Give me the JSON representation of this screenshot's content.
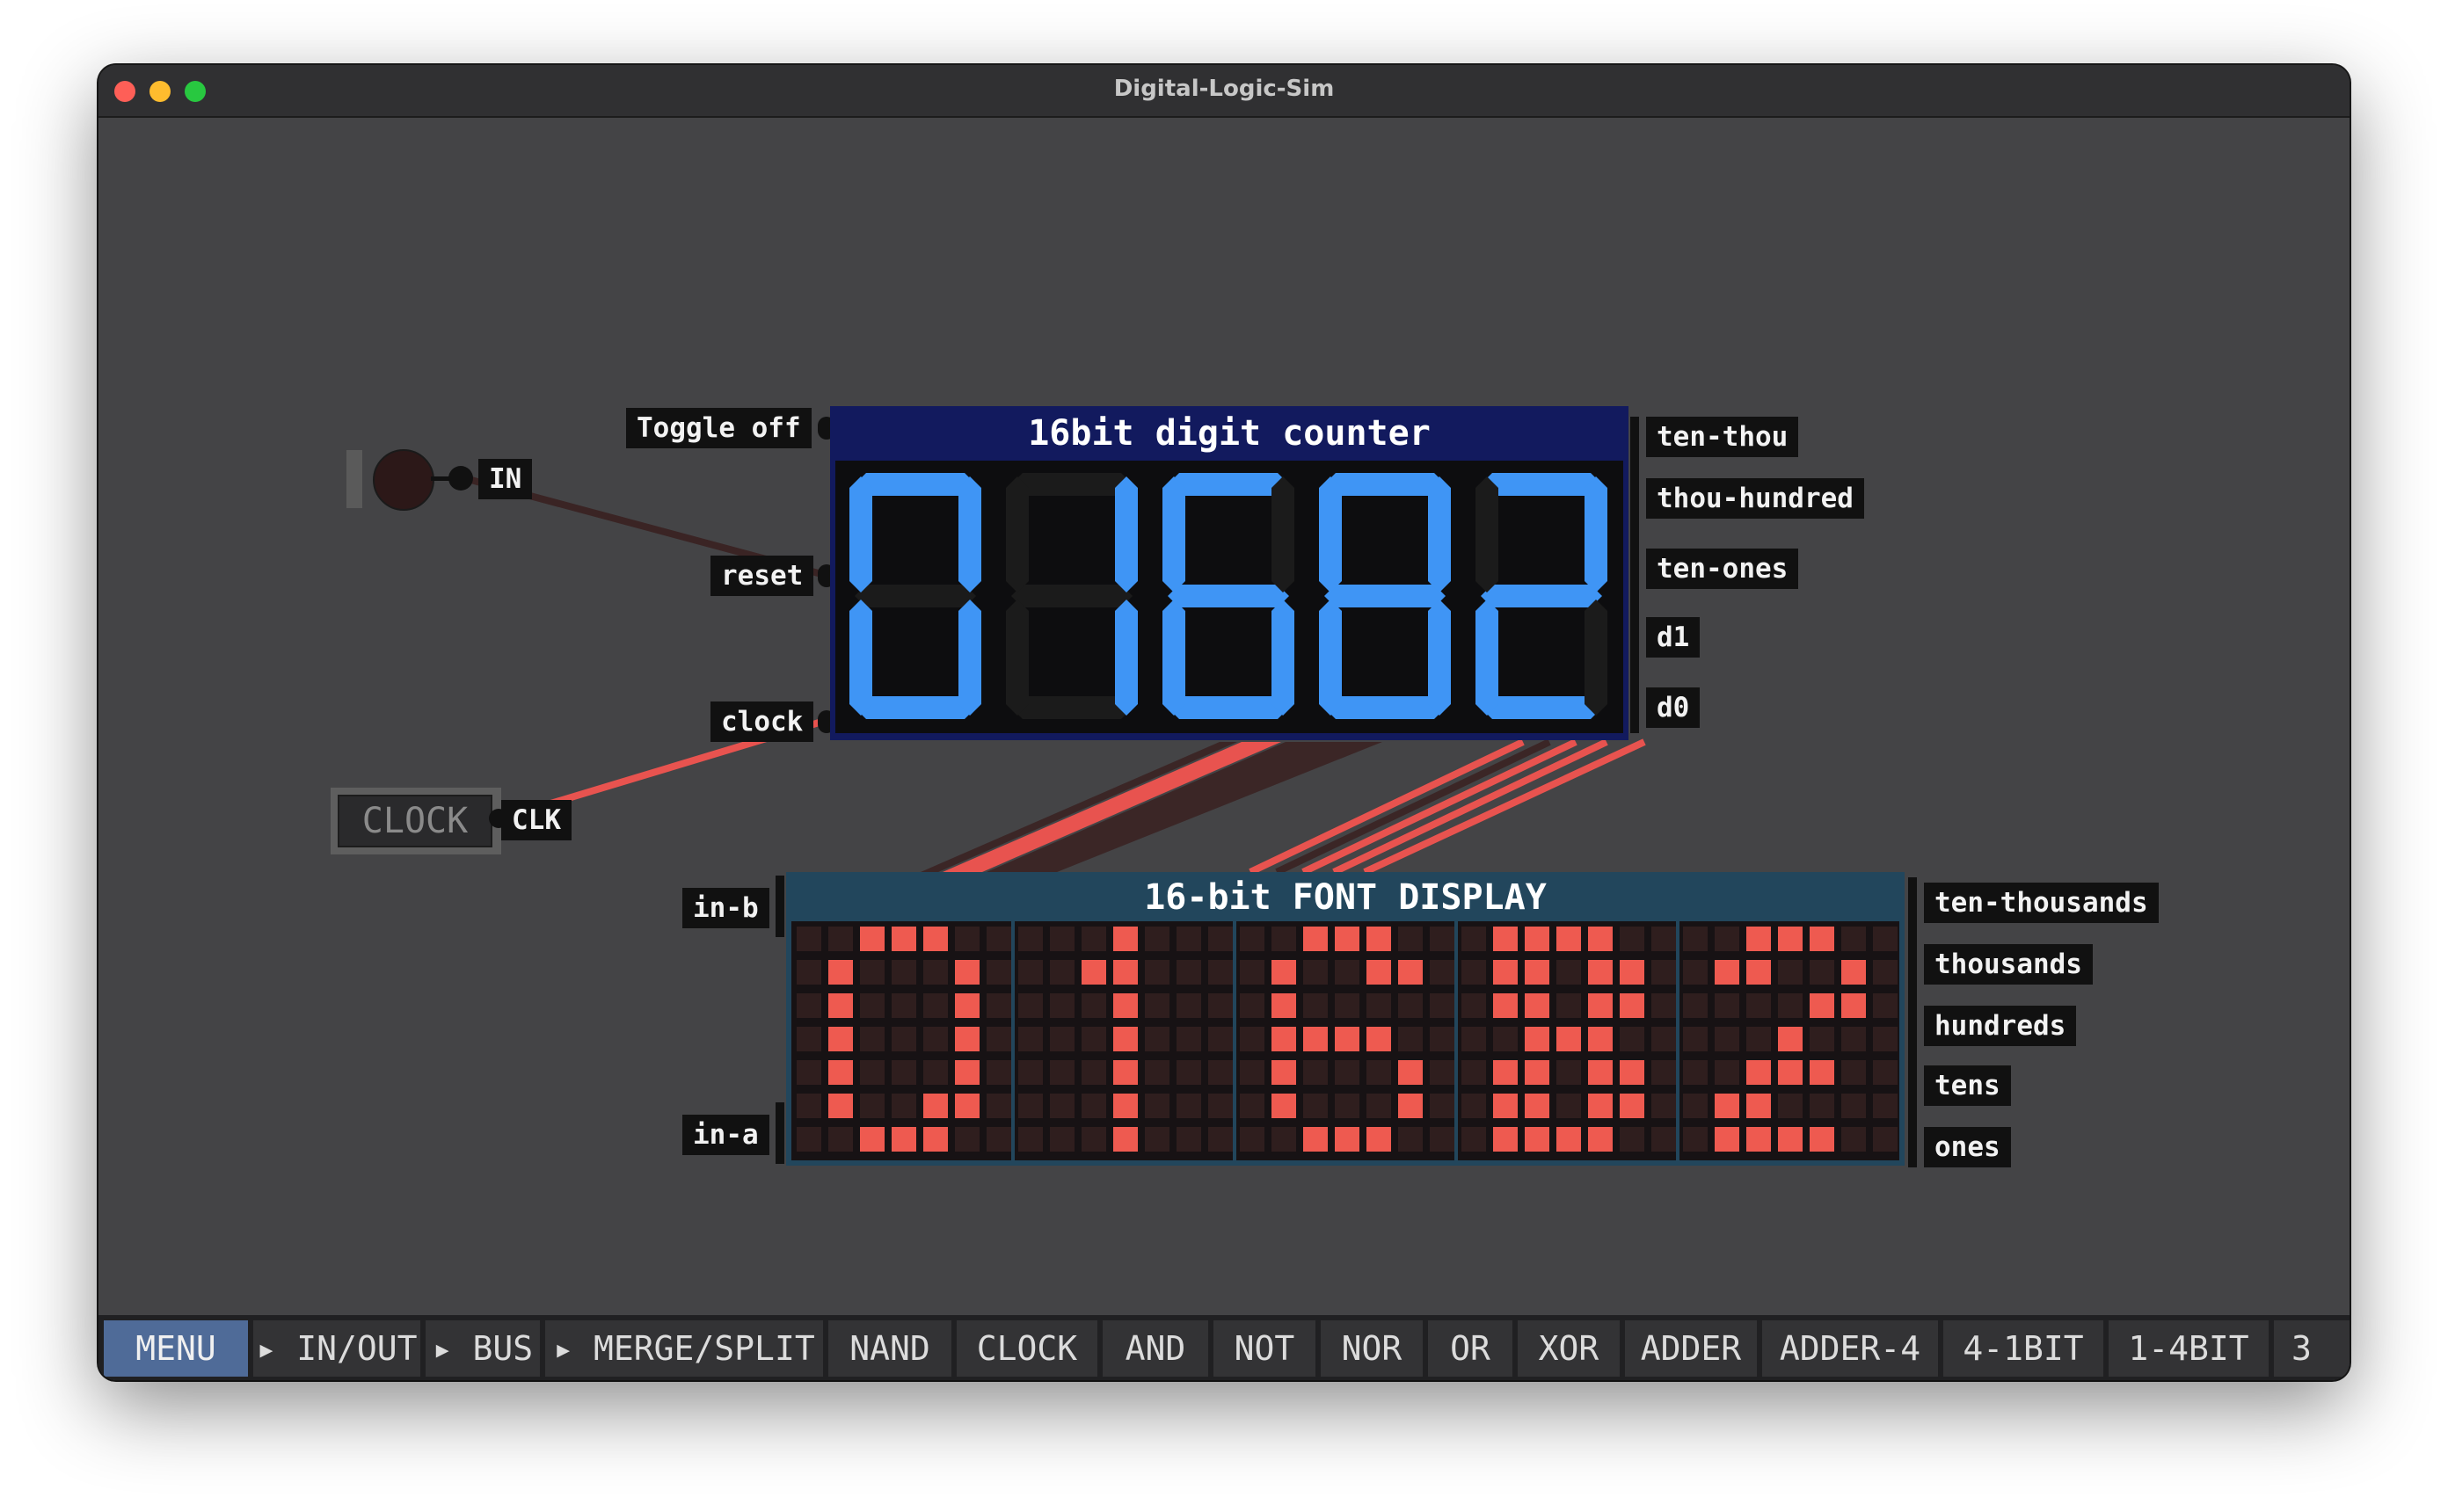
{
  "window": {
    "title": "Digital-Logic-Sim"
  },
  "colors": {
    "wire_on": "#e8534f",
    "wire_off": "#3a2424",
    "segment_on": "#3f95f5",
    "segment_off": "#1b1b1b",
    "pixel_on": "#ee5a50",
    "pixel_off": "#2f1e1e",
    "counter_chip": "#121a5e",
    "font_chip": "#22465c",
    "menu_active": "#4f6b98"
  },
  "inputs": {
    "toggle": {
      "label": "IN",
      "state": "off"
    },
    "clock": {
      "button_label": "CLOCK",
      "pin_label": "CLK"
    }
  },
  "counter_chip": {
    "title": "16bit digit counter",
    "input_pins": [
      "Toggle off",
      "reset",
      "clock"
    ],
    "output_pins": [
      "ten-thou",
      "thou-hundred",
      "ten-ones",
      "d1",
      "d0"
    ],
    "digits": [
      "0",
      "1",
      "6",
      "8",
      "2"
    ]
  },
  "font_chip": {
    "title": "16-bit FONT DISPLAY",
    "input_pins": [
      "in-b",
      "in-a"
    ],
    "output_pins": [
      "ten-thousands",
      "thousands",
      "hundreds",
      "tens",
      "ones"
    ],
    "glyphs": [
      [
        "0011100",
        "0100010",
        "0100010",
        "0100010",
        "0100010",
        "0100110",
        "0011100"
      ],
      [
        "0001000",
        "0011000",
        "0001000",
        "0001000",
        "0001000",
        "0001000",
        "0001000"
      ],
      [
        "0011100",
        "0100110",
        "0100000",
        "0111100",
        "0100010",
        "0100010",
        "0011100"
      ],
      [
        "0111100",
        "0110110",
        "0110110",
        "0011100",
        "0110110",
        "0110110",
        "0111100"
      ],
      [
        "0011100",
        "0110010",
        "0000110",
        "0001000",
        "0011100",
        "0110000",
        "0111100"
      ]
    ]
  },
  "toolbar": {
    "items": [
      {
        "label": "MENU",
        "active": true
      },
      {
        "label": "▸ IN/OUT",
        "active": false
      },
      {
        "label": "▸ BUS",
        "active": false
      },
      {
        "label": "▸ MERGE/SPLIT",
        "active": false
      },
      {
        "label": "NAND",
        "active": false
      },
      {
        "label": "CLOCK",
        "active": false
      },
      {
        "label": "AND",
        "active": false
      },
      {
        "label": "NOT",
        "active": false
      },
      {
        "label": "NOR",
        "active": false
      },
      {
        "label": "OR",
        "active": false
      },
      {
        "label": "XOR",
        "active": false
      },
      {
        "label": "ADDER",
        "active": false
      },
      {
        "label": "ADDER-4",
        "active": false
      },
      {
        "label": "4-1BIT",
        "active": false
      },
      {
        "label": "1-4BIT",
        "active": false
      },
      {
        "label": "3",
        "active": false
      }
    ]
  }
}
